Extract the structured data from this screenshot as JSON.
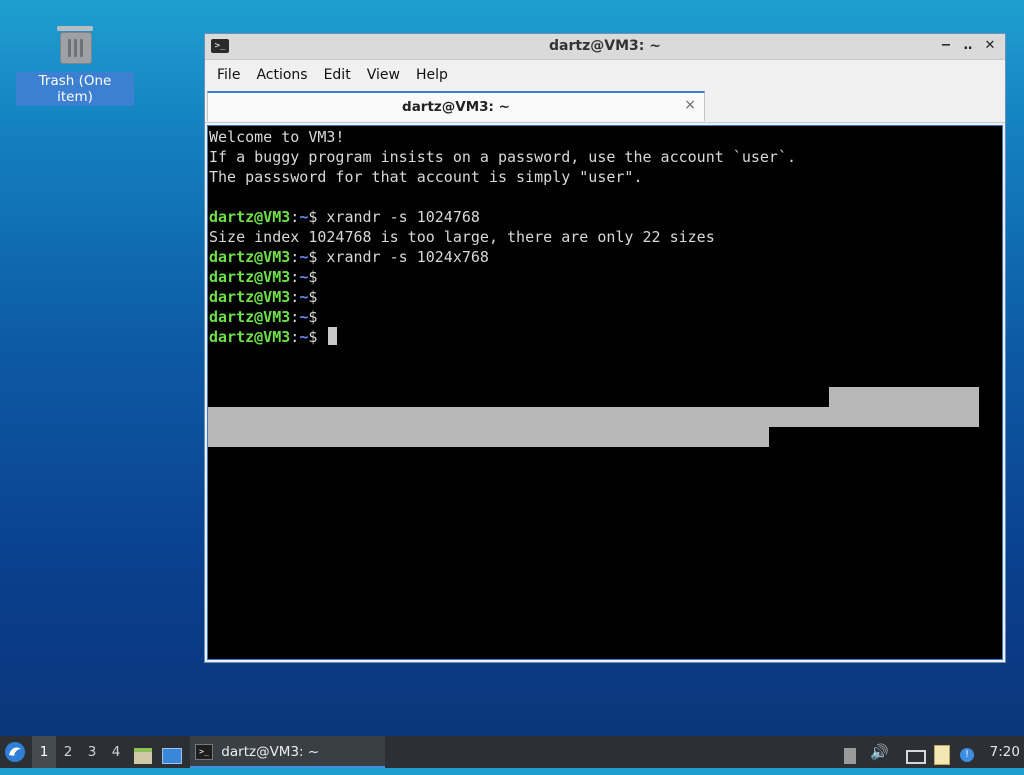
{
  "desktop": {
    "trash_label": "Trash (One item)",
    "trash_icon": "trash-icon"
  },
  "window": {
    "title": "dartz@VM3: ~",
    "title_icon": "terminal-icon",
    "controls": {
      "minimize": "−",
      "maximize": "‥",
      "close": "✕"
    },
    "menu": [
      "File",
      "Actions",
      "Edit",
      "View",
      "Help"
    ],
    "tab": {
      "title": "dartz@VM3: ~",
      "close": "×"
    }
  },
  "terminal": {
    "output": [
      "Welcome to VM3!",
      "If a buggy program insists on a password, use the account `user`.",
      "The passsword for that account is simply \"user\"."
    ],
    "prompt": {
      "user_host": "dartz@VM3",
      "colon": ":",
      "path": "~",
      "symbol": "$"
    },
    "cmd1": "xrandr -s 1024768",
    "response1": "Size index 1024768 is too large, there are only 22 sizes",
    "cmd2": "xrandr -s 1024x768"
  },
  "taskbar": {
    "start_icon": "start-menu-icon",
    "workspaces": [
      "1",
      "2",
      "3",
      "4"
    ],
    "active_workspace": "1",
    "task_title": "dartz@VM3: ~",
    "tray_icons": [
      "eject-icon",
      "volume-icon",
      "network-icon",
      "clipboard-icon",
      "notification-icon"
    ],
    "clock": "7:20"
  },
  "colors": {
    "prompt_user": "#6fe04a",
    "prompt_path": "#6b8cff",
    "accent": "#3b7fcf"
  }
}
